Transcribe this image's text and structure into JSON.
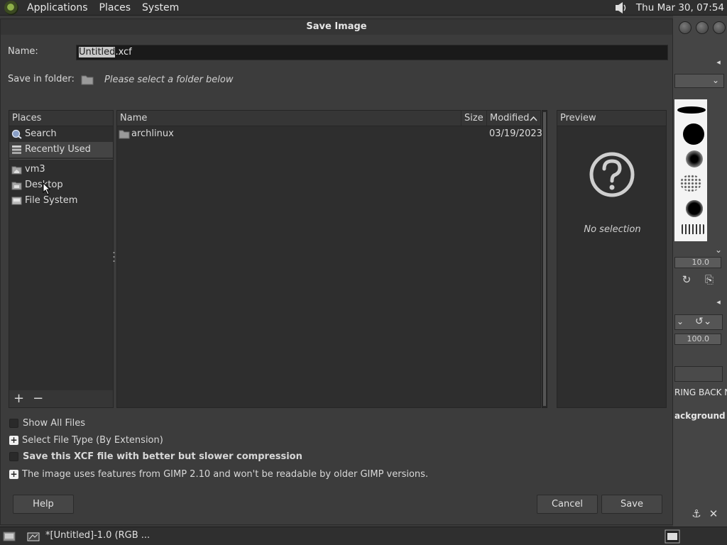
{
  "top_panel": {
    "menus": [
      "Applications",
      "Places",
      "System"
    ],
    "clock": "Thu Mar 30, 07:54"
  },
  "dialog": {
    "title": "Save Image",
    "name_label": "Name:",
    "name_value_selected": "Untitled",
    "name_value_ext": ".xcf",
    "save_in_label": "Save in folder:",
    "save_in_hint": "Please select a folder below"
  },
  "places": {
    "header": "Places",
    "items": [
      {
        "label": "Search",
        "icon": "search-icon"
      },
      {
        "label": "Recently Used",
        "icon": "recent-icon"
      },
      {
        "label": "vm3",
        "icon": "home-folder-icon"
      },
      {
        "label": "Desktop",
        "icon": "desktop-icon"
      },
      {
        "label": "File System",
        "icon": "drive-icon"
      }
    ],
    "add_label": "+",
    "remove_label": "−"
  },
  "files": {
    "columns": {
      "name": "Name",
      "size": "Size",
      "modified": "Modified"
    },
    "rows": [
      {
        "name": "archlinux",
        "size": "",
        "modified": "03/19/2023",
        "icon": "folder-icon"
      }
    ]
  },
  "preview": {
    "header": "Preview",
    "empty_text": "No selection"
  },
  "options": {
    "show_all_files": "Show All Files",
    "select_file_type": "Select File Type (By Extension)",
    "better_compression": "Save this XCF file with better but slower compression",
    "compat_notice": "The image uses features from GIMP 2.10 and won't be readable by older GIMP versions."
  },
  "buttons": {
    "help": "Help",
    "cancel": "Cancel",
    "save": "Save"
  },
  "gimp_background": {
    "brush_size": "10.0",
    "opacity": "100.0",
    "layer_text": "RING BACK N",
    "background_text": "ackground"
  },
  "taskbar": {
    "task_title": "*[Untitled]-1.0 (RGB ..."
  },
  "colors": {
    "dialog_bg": "#3c3c3c",
    "panel_bg": "#2e2e2e",
    "input_bg": "#1a1a1a"
  }
}
